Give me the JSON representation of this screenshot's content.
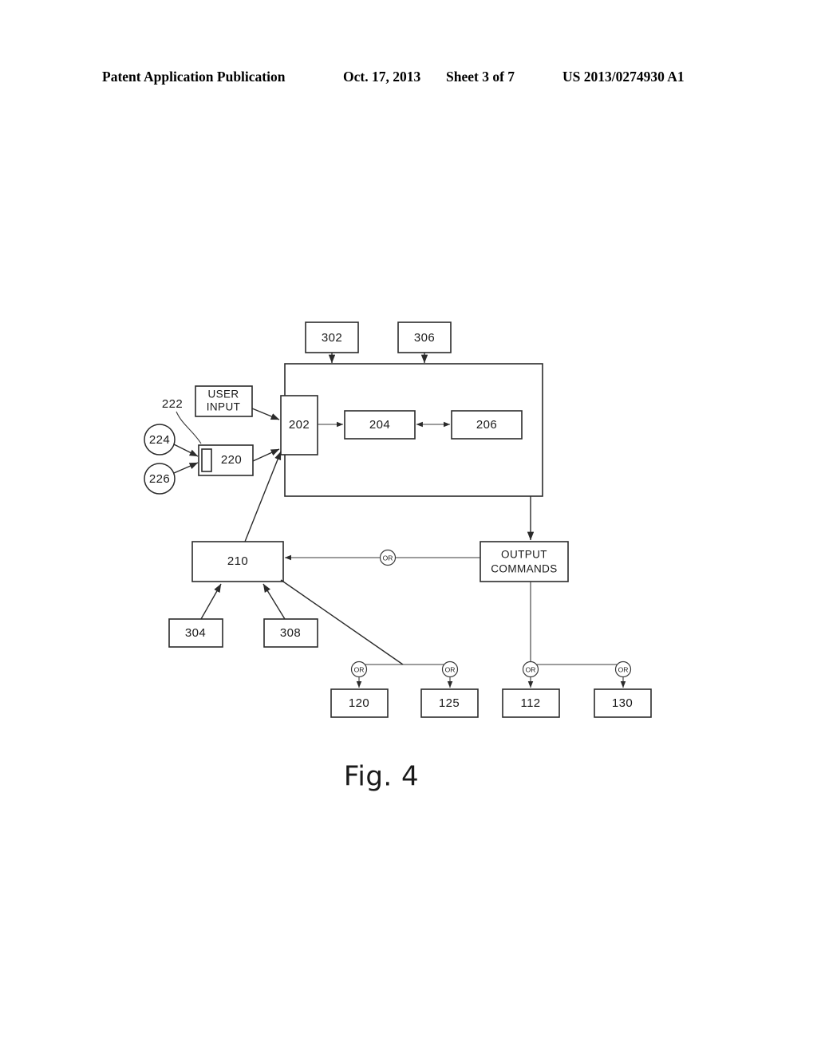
{
  "header": {
    "publication": "Patent Application Publication",
    "date": "Oct. 17, 2013",
    "sheet": "Sheet 3 of 7",
    "patent_number": "US 2013/0274930 A1"
  },
  "figure": {
    "caption": "Fig. 4",
    "or_symbol": "OR",
    "boxes": {
      "b302": "302",
      "b306": "306",
      "user_input": "USER\nINPUT",
      "user_input_line1": "USER",
      "user_input_line2": "INPUT",
      "b220": "220",
      "b202": "202",
      "b204": "204",
      "b206": "206",
      "b210": "210",
      "b304": "304",
      "b308": "308",
      "output_commands_line1": "OUTPUT",
      "output_commands_line2": "COMMANDS",
      "b120": "120",
      "b125": "125",
      "b112": "112",
      "b130": "130"
    },
    "callouts": {
      "c222": "222",
      "c224": "224",
      "c226": "226"
    },
    "or_gates": [
      "OR",
      "OR",
      "OR",
      "OR",
      "OR"
    ]
  },
  "colors": {
    "ink": "#1a1a1a",
    "stroke": "#2b2b2b",
    "background": "#ffffff"
  }
}
